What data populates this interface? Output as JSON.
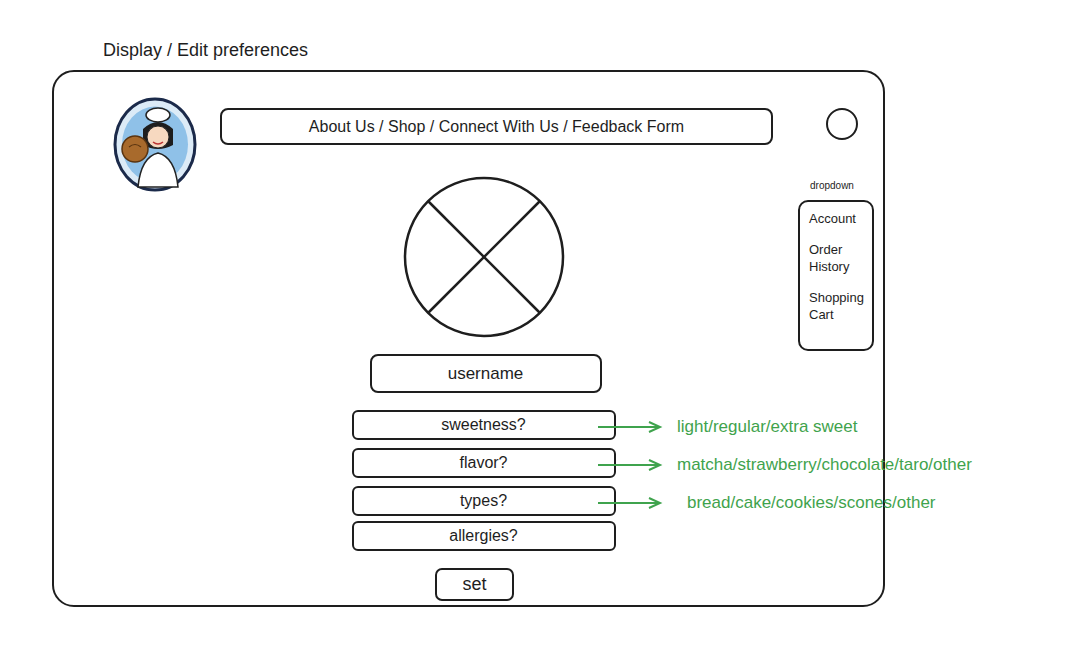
{
  "page_title": "Display / Edit preferences",
  "nav": {
    "text": "About Us / Shop / Connect With Us / Feedback Form"
  },
  "dropdown": {
    "label": "dropdown",
    "items": [
      "Account",
      "Order History",
      "Shopping Cart"
    ]
  },
  "username": {
    "label": "username"
  },
  "fields": [
    {
      "label": "sweetness?",
      "options": "light/regular/extra sweet"
    },
    {
      "label": "flavor?",
      "options": "matcha/strawberry/chocolate/taro/other"
    },
    {
      "label": "types?",
      "options": "bread/cake/cookies/scones/other"
    },
    {
      "label": "allergies?"
    }
  ],
  "button": "set"
}
